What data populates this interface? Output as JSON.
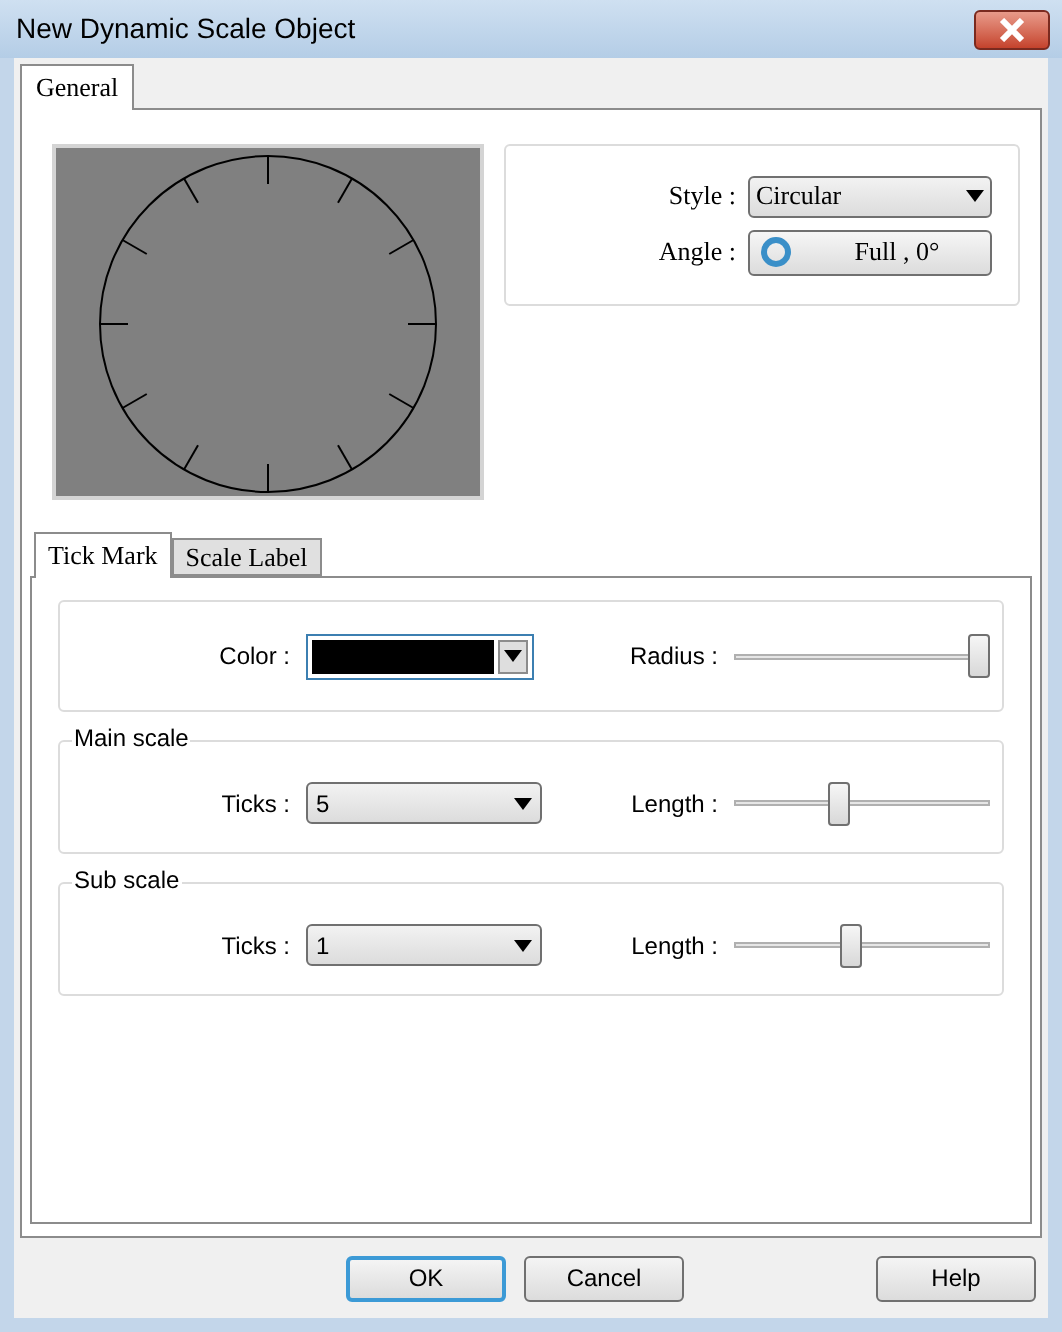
{
  "window": {
    "title": "New Dynamic Scale Object"
  },
  "tabs": [
    {
      "label": "General",
      "selected": true
    }
  ],
  "style": {
    "label": "Style :",
    "value": "Circular"
  },
  "angle": {
    "label": "Angle :",
    "value": "Full , 0°"
  },
  "sub_tabs": [
    {
      "label": "Tick Mark",
      "selected": true
    },
    {
      "label": "Scale Label",
      "selected": false
    }
  ],
  "color": {
    "label": "Color :"
  },
  "radius": {
    "label": "Radius :",
    "level": 1.0
  },
  "groups": [
    {
      "title": "Main scale",
      "ticks_label": "Ticks :",
      "ticks": "5",
      "length_label": "Length :",
      "level": 0.4
    },
    {
      "title": "Sub scale",
      "ticks_label": "Ticks :",
      "ticks": "1",
      "length_label": "Length :",
      "level": 0.45
    }
  ],
  "buttons": [
    {
      "label": "OK",
      "default": true
    },
    {
      "label": "Cancel",
      "default": false
    },
    {
      "label": "Help",
      "default": false
    }
  ]
}
